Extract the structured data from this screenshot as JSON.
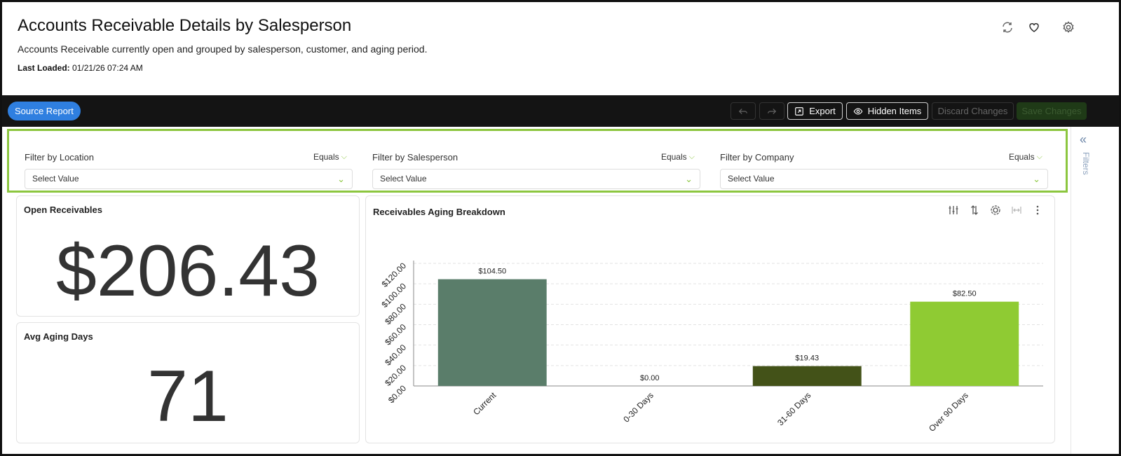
{
  "header": {
    "title": "Accounts Receivable Details by Salesperson",
    "subtitle": "Accounts Receivable currently open and grouped by salesperson, customer, and aging period.",
    "last_loaded_label": "Last Loaded:",
    "last_loaded_value": "01/21/26 07:24 AM",
    "icons": [
      "refresh-icon",
      "heart-icon",
      "gear-icon"
    ]
  },
  "toolbar": {
    "source_report": "Source Report",
    "export": "Export",
    "hidden_items": "Hidden Items",
    "discard_changes": "Discard Changes",
    "save_changes": "Save Changes"
  },
  "filters": [
    {
      "label": "Filter by Location",
      "operator": "Equals",
      "placeholder": "Select Value"
    },
    {
      "label": "Filter by Salesperson",
      "operator": "Equals",
      "placeholder": "Select Value"
    },
    {
      "label": "Filter by Company",
      "operator": "Equals",
      "placeholder": "Select Value"
    }
  ],
  "rail": {
    "label": "Filters"
  },
  "kpis": {
    "open_receivables": {
      "title": "Open Receivables",
      "value": "$206.43"
    },
    "avg_aging_days": {
      "title": "Avg Aging Days",
      "value": "71"
    }
  },
  "chart_panel": {
    "title": "Receivables Aging Breakdown"
  },
  "colors": {
    "accent_green": "#8cc63f",
    "source_blue": "#2f7fe0",
    "toolbar_bg": "#141414"
  },
  "chart_data": {
    "type": "bar",
    "title": "Receivables Aging Breakdown",
    "categories": [
      "Current",
      "0-30 Days",
      "31-60 Days",
      "Over 90 Days"
    ],
    "values": [
      104.5,
      0.0,
      19.43,
      82.5
    ],
    "value_labels": [
      "$104.50",
      "$0.00",
      "$19.43",
      "$82.50"
    ],
    "bar_colors": [
      "#5a7d6a",
      "#5a7d6a",
      "#435218",
      "#8fcb33"
    ],
    "ylim": [
      0,
      120
    ],
    "yticks": [
      "$0.00",
      "$20.00",
      "$40.00",
      "$60.00",
      "$80.00",
      "$100.00",
      "$120.00"
    ],
    "ytick_values": [
      0,
      20,
      40,
      60,
      80,
      100,
      120
    ],
    "grid": true,
    "legend": "none"
  }
}
